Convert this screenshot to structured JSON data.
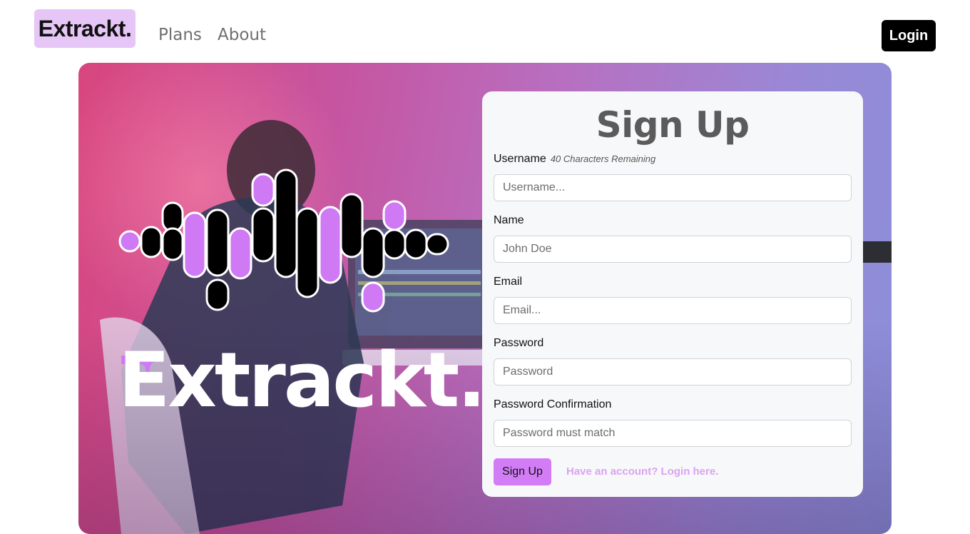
{
  "nav": {
    "brand": "Extrackt.",
    "links": [
      {
        "label": "Plans"
      },
      {
        "label": "About"
      }
    ],
    "login_label": "Login"
  },
  "hero": {
    "logo_text": "Extrackt"
  },
  "form": {
    "title": "Sign Up",
    "fields": [
      {
        "label": "Username",
        "hint": "40 Characters Remaining",
        "placeholder": "Username..."
      },
      {
        "label": "Name",
        "placeholder": "John Doe"
      },
      {
        "label": "Email",
        "placeholder": "Email..."
      },
      {
        "label": "Password",
        "placeholder": "Password"
      },
      {
        "label": "Password Confirmation",
        "placeholder": "Password must match"
      }
    ],
    "submit_label": "Sign Up",
    "login_link": "Have an account? Login here."
  },
  "colors": {
    "brand_bg": "#e6c6f6",
    "accent": "#d27df6",
    "link": "#dba3f0",
    "button_dark": "#000000"
  },
  "icons": [
    "sound-wave-logo",
    "drip-accent"
  ]
}
